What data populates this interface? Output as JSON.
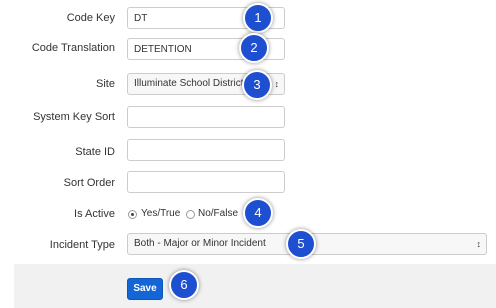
{
  "form": {
    "code_key": {
      "label": "Code Key",
      "value": "DT"
    },
    "code_translation": {
      "label": "Code Translation",
      "value": "DETENTION"
    },
    "site": {
      "label": "Site",
      "value": "Illuminate School District"
    },
    "system_key_sort": {
      "label": "System Key Sort",
      "value": ""
    },
    "state_id": {
      "label": "State ID",
      "value": ""
    },
    "sort_order": {
      "label": "Sort Order",
      "value": ""
    },
    "is_active": {
      "label": "Is Active",
      "options": [
        "Yes/True",
        "No/False"
      ],
      "selected": "Yes/True"
    },
    "incident_type": {
      "label": "Incident Type",
      "value": "Both - Major or Minor Incident"
    }
  },
  "footer": {
    "save_label": "Save"
  },
  "callouts": [
    "1",
    "2",
    "3",
    "4",
    "5",
    "6"
  ],
  "colors": {
    "badge": "#1f4fd1",
    "save_button": "#1466d6",
    "footer_bg": "#f1f1f1"
  }
}
